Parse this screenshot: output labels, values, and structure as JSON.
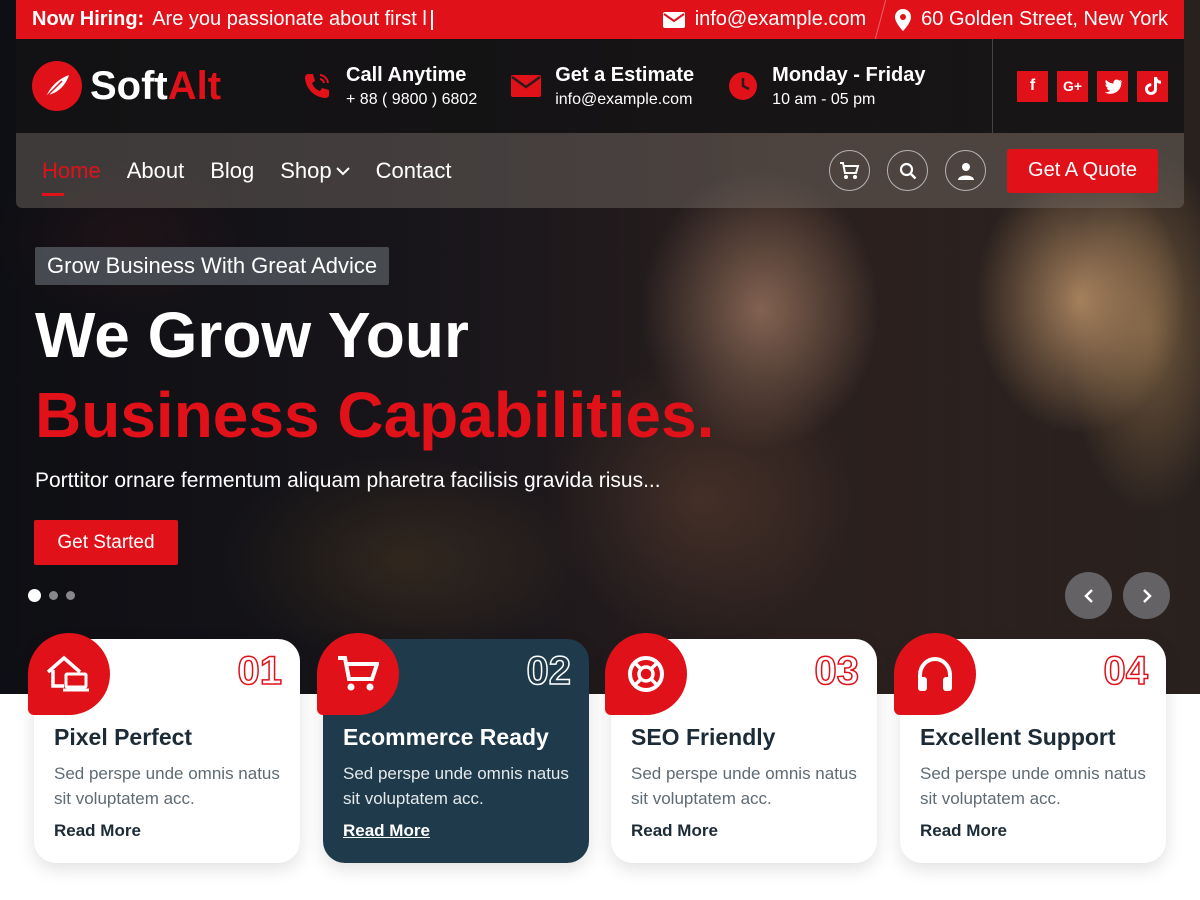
{
  "topbar": {
    "hiring_label": "Now Hiring:",
    "hiring_text": "Are you passionate about first l",
    "email": "info@example.com",
    "address": "60 Golden Street, New York"
  },
  "logo": {
    "part1": "Soft",
    "part2": "Alt"
  },
  "contacts": [
    {
      "title": "Call Anytime",
      "sub": "+ 88 ( 9800 ) 6802",
      "icon": "phone-icon"
    },
    {
      "title": "Get a Estimate",
      "sub": "info@example.com",
      "icon": "envelope-icon"
    },
    {
      "title": "Monday - Friday",
      "sub": "10 am - 05 pm",
      "icon": "clock-icon"
    }
  ],
  "socials": [
    "f",
    "G+",
    "twitter",
    "tiktok"
  ],
  "nav": {
    "items": [
      "Home",
      "About",
      "Blog",
      "Shop",
      "Contact"
    ],
    "quote_label": "Get A Quote"
  },
  "hero": {
    "tagline": "Grow Business With Great Advice",
    "headline1": "We Grow Your",
    "headline2": "Business Capabilities.",
    "description": "Porttitor ornare fermentum aliquam pharetra facilisis gravida risus...",
    "cta_label": "Get Started"
  },
  "cards": [
    {
      "num": "01",
      "title": "Pixel Perfect",
      "desc": "Sed perspe unde omnis natus sit voluptatem acc.",
      "link": "Read More"
    },
    {
      "num": "02",
      "title": "Ecommerce Ready",
      "desc": "Sed perspe unde omnis natus sit voluptatem acc.",
      "link": "Read More"
    },
    {
      "num": "03",
      "title": "SEO Friendly",
      "desc": "Sed perspe unde omnis natus sit voluptatem acc.",
      "link": "Read More"
    },
    {
      "num": "04",
      "title": "Excellent Support",
      "desc": "Sed perspe unde omnis natus sit voluptatem acc.",
      "link": "Read More"
    }
  ],
  "colors": {
    "accent": "#e1111a",
    "dark_card": "#1f3a4a",
    "heading": "#1c2b36"
  }
}
